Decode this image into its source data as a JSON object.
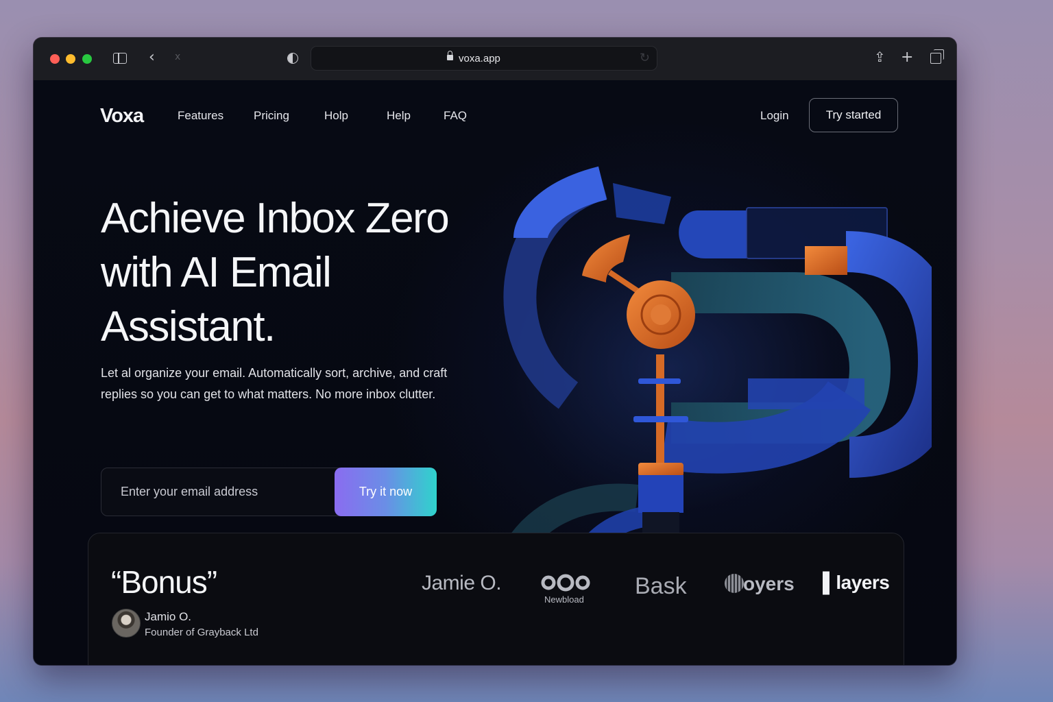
{
  "browser": {
    "url": "voxa.app",
    "icons": [
      "sidebar-icon",
      "back-icon",
      "forward-icon",
      "shield-icon",
      "lock-icon",
      "reload-icon",
      "share-icon",
      "plus-icon",
      "tabs-icon"
    ]
  },
  "header": {
    "logo": "Voxa",
    "nav": [
      "Features",
      "Pricing",
      "Holp",
      "Help",
      "FAQ"
    ],
    "login": "Login",
    "cta": "Try started"
  },
  "hero": {
    "headline": [
      "Achieve Inbox Zero",
      "with AI Email",
      "Assistant."
    ],
    "subtitle": [
      "Let al organize your email. Automatically sort, archive, and craft",
      "replies so you can get to what matters. No more inbox clutter."
    ],
    "email_placeholder": "Enter your email address",
    "button": "Try it now"
  },
  "testimonial": {
    "quote": "“Bonus”",
    "author": "Jamio O.",
    "role": "Founder of Grayback Ltd"
  },
  "brands": {
    "jamie": "Jamie O.",
    "newbload": "Newbload",
    "bask": "Bask",
    "oyers": "oyers",
    "layers": "layers"
  },
  "colors": {
    "accent_gradient_start": "#8a6cf0",
    "accent_gradient_end": "#2fd3cc",
    "art_orange": "#e0702a",
    "art_blue": "#2f4fc8",
    "background": "#06080f"
  }
}
